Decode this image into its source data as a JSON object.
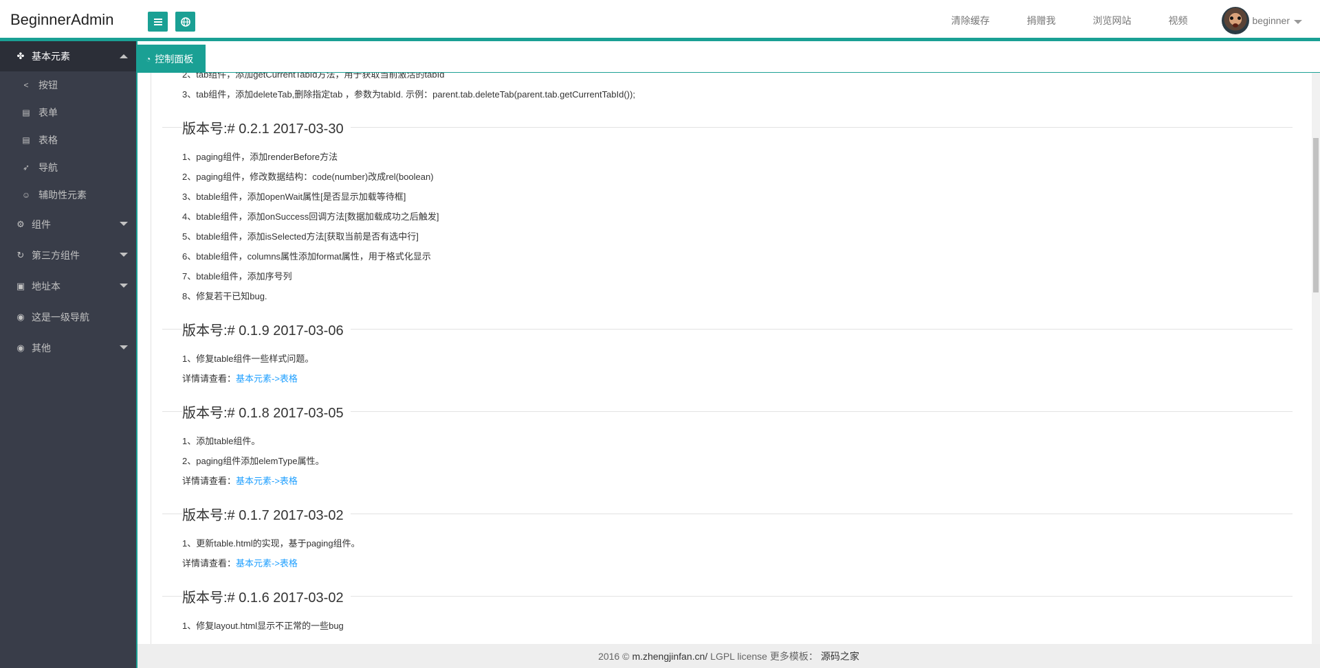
{
  "header": {
    "logo": "BeginnerAdmin",
    "nav": [
      "清除缓存",
      "捐赠我",
      "浏览网站",
      "视频"
    ],
    "user": "beginner"
  },
  "sidebar": {
    "groups": [
      {
        "label": "基本元素",
        "icon": "cubes-icon",
        "open": true,
        "items": [
          {
            "label": "按钮",
            "icon": "share-icon"
          },
          {
            "label": "表单",
            "icon": "form-icon"
          },
          {
            "label": "表格",
            "icon": "table-icon"
          },
          {
            "label": "导航",
            "icon": "navigation-icon"
          },
          {
            "label": "辅助性元素",
            "icon": "smile-icon"
          }
        ]
      },
      {
        "label": "组件",
        "icon": "gears-icon"
      },
      {
        "label": "第三方组件",
        "icon": "refresh-icon"
      },
      {
        "label": "地址本",
        "icon": "address-book-icon"
      },
      {
        "label": "这是一级导航",
        "icon": "circle-icon"
      },
      {
        "label": "其他",
        "icon": "circle-icon"
      }
    ]
  },
  "tab": {
    "label": "控制面板",
    "icon": "dashboard-icon"
  },
  "content": {
    "pre_lines": [
      "2、tab组件，添加getCurrentTabId方法，用于获取当前激活的tabId",
      "3、tab组件，添加deleteTab,删除指定tab ，参数为tabId. 示例：parent.tab.deleteTab(parent.tab.getCurrentTabId());"
    ],
    "versions": [
      {
        "title": "版本号:# 0.2.1 2017-03-30",
        "lines": [
          "1、paging组件，添加renderBefore方法",
          "2、paging组件，修改数据结构：code(number)改成rel(boolean)",
          "3、btable组件，添加openWait属性[是否显示加载等待框]",
          "4、btable组件，添加onSuccess回调方法[数据加载成功之后触发]",
          "5、btable组件，添加isSelected方法[获取当前是否有选中行]",
          "6、btable组件，columns属性添加format属性，用于格式化显示",
          "7、btable组件，添加序号列",
          "8、修复若干已知bug."
        ]
      },
      {
        "title": "版本号:# 0.1.9 2017-03-06",
        "lines": [
          "1、修复table组件一些样式问题。"
        ],
        "detail_prefix": "详情请查看：",
        "detail_link": "基本元素->表格"
      },
      {
        "title": "版本号:# 0.1.8 2017-03-05",
        "lines": [
          "1、添加table组件。",
          "2、paging组件添加elemType属性。"
        ],
        "detail_prefix": "详情请查看：",
        "detail_link": "基本元素->表格"
      },
      {
        "title": "版本号:# 0.1.7 2017-03-02",
        "lines": [
          "1、更新table.html的实现，基于paging组件。"
        ],
        "detail_prefix": "详情请查看：",
        "detail_link": "基本元素->表格"
      },
      {
        "title": "版本号:# 0.1.6 2017-03-02",
        "lines": [
          "1、修复layout.html显示不正常的一些bug"
        ]
      }
    ]
  },
  "footer": {
    "prefix": "2016 ©",
    "site": "m.zhengjinfan.cn/",
    "license": "LGPL license",
    "more": "更多模板：",
    "link": "源码之家"
  },
  "colors": {
    "accent": "#1aa094",
    "sidebar": "#393d49",
    "link": "#1e9fff"
  }
}
